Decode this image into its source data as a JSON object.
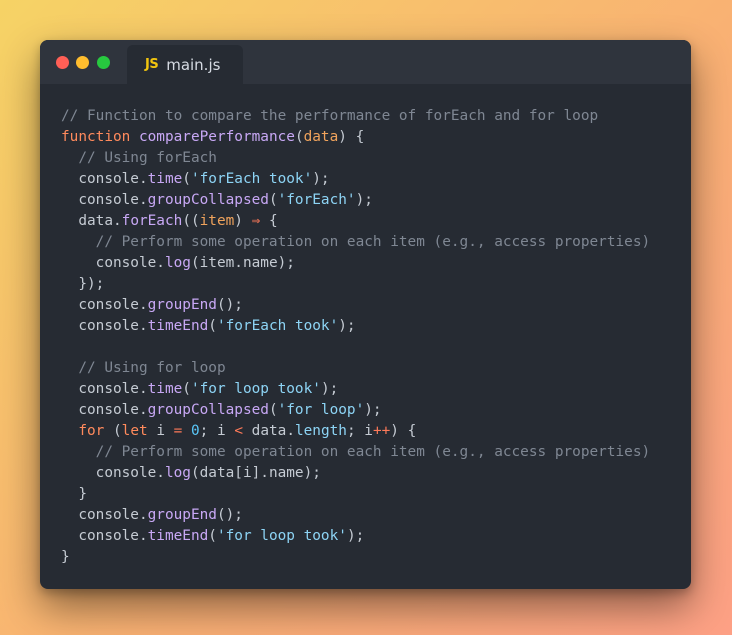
{
  "window": {
    "tab": {
      "icon_text": "JS",
      "label": "main.js"
    }
  },
  "code": {
    "lines": [
      [
        {
          "t": "// Function to compare the performance of forEach and for loop",
          "k": "comment"
        }
      ],
      [
        {
          "t": "function",
          "k": "keyword"
        },
        {
          "t": " ",
          "k": "plain"
        },
        {
          "t": "comparePerformance",
          "k": "function"
        },
        {
          "t": "(",
          "k": "plain"
        },
        {
          "t": "data",
          "k": "param"
        },
        {
          "t": ") {",
          "k": "plain"
        }
      ],
      [
        {
          "t": "  // Using forEach",
          "k": "comment"
        }
      ],
      [
        {
          "t": "  console.",
          "k": "plain"
        },
        {
          "t": "time",
          "k": "method"
        },
        {
          "t": "(",
          "k": "plain"
        },
        {
          "t": "'forEach took'",
          "k": "string"
        },
        {
          "t": ");",
          "k": "plain"
        }
      ],
      [
        {
          "t": "  console.",
          "k": "plain"
        },
        {
          "t": "groupCollapsed",
          "k": "method"
        },
        {
          "t": "(",
          "k": "plain"
        },
        {
          "t": "'forEach'",
          "k": "string"
        },
        {
          "t": ");",
          "k": "plain"
        }
      ],
      [
        {
          "t": "  data.",
          "k": "plain"
        },
        {
          "t": "forEach",
          "k": "method"
        },
        {
          "t": "((",
          "k": "plain"
        },
        {
          "t": "item",
          "k": "param"
        },
        {
          "t": ") ",
          "k": "plain"
        },
        {
          "t": "⇒",
          "k": "operator"
        },
        {
          "t": " {",
          "k": "plain"
        }
      ],
      [
        {
          "t": "    // Perform some operation on each item (e.g., access properties)",
          "k": "comment"
        }
      ],
      [
        {
          "t": "    console.",
          "k": "plain"
        },
        {
          "t": "log",
          "k": "method"
        },
        {
          "t": "(item.name);",
          "k": "plain"
        }
      ],
      [
        {
          "t": "  });",
          "k": "plain"
        }
      ],
      [
        {
          "t": "  console.",
          "k": "plain"
        },
        {
          "t": "groupEnd",
          "k": "method"
        },
        {
          "t": "();",
          "k": "plain"
        }
      ],
      [
        {
          "t": "  console.",
          "k": "plain"
        },
        {
          "t": "timeEnd",
          "k": "method"
        },
        {
          "t": "(",
          "k": "plain"
        },
        {
          "t": "'forEach took'",
          "k": "string"
        },
        {
          "t": ");",
          "k": "plain"
        }
      ],
      [],
      [
        {
          "t": "  // Using for loop",
          "k": "comment"
        }
      ],
      [
        {
          "t": "  console.",
          "k": "plain"
        },
        {
          "t": "time",
          "k": "method"
        },
        {
          "t": "(",
          "k": "plain"
        },
        {
          "t": "'for loop took'",
          "k": "string"
        },
        {
          "t": ");",
          "k": "plain"
        }
      ],
      [
        {
          "t": "  console.",
          "k": "plain"
        },
        {
          "t": "groupCollapsed",
          "k": "method"
        },
        {
          "t": "(",
          "k": "plain"
        },
        {
          "t": "'for loop'",
          "k": "string"
        },
        {
          "t": ");",
          "k": "plain"
        }
      ],
      [
        {
          "t": "  ",
          "k": "plain"
        },
        {
          "t": "for",
          "k": "keyword"
        },
        {
          "t": " (",
          "k": "plain"
        },
        {
          "t": "let",
          "k": "keyword"
        },
        {
          "t": " i ",
          "k": "plain"
        },
        {
          "t": "=",
          "k": "operator"
        },
        {
          "t": " ",
          "k": "plain"
        },
        {
          "t": "0",
          "k": "number"
        },
        {
          "t": "; i ",
          "k": "plain"
        },
        {
          "t": "<",
          "k": "operator"
        },
        {
          "t": " data.",
          "k": "plain"
        },
        {
          "t": "length",
          "k": "property"
        },
        {
          "t": "; i",
          "k": "plain"
        },
        {
          "t": "++",
          "k": "operator"
        },
        {
          "t": ") {",
          "k": "plain"
        }
      ],
      [
        {
          "t": "    // Perform some operation on each item (e.g., access properties)",
          "k": "comment"
        }
      ],
      [
        {
          "t": "    console.",
          "k": "plain"
        },
        {
          "t": "log",
          "k": "method"
        },
        {
          "t": "(data[i].name);",
          "k": "plain"
        }
      ],
      [
        {
          "t": "  }",
          "k": "plain"
        }
      ],
      [
        {
          "t": "  console.",
          "k": "plain"
        },
        {
          "t": "groupEnd",
          "k": "method"
        },
        {
          "t": "();",
          "k": "plain"
        }
      ],
      [
        {
          "t": "  console.",
          "k": "plain"
        },
        {
          "t": "timeEnd",
          "k": "method"
        },
        {
          "t": "(",
          "k": "plain"
        },
        {
          "t": "'for loop took'",
          "k": "string"
        },
        {
          "t": ");",
          "k": "plain"
        }
      ],
      [
        {
          "t": "}",
          "k": "plain"
        }
      ]
    ]
  }
}
